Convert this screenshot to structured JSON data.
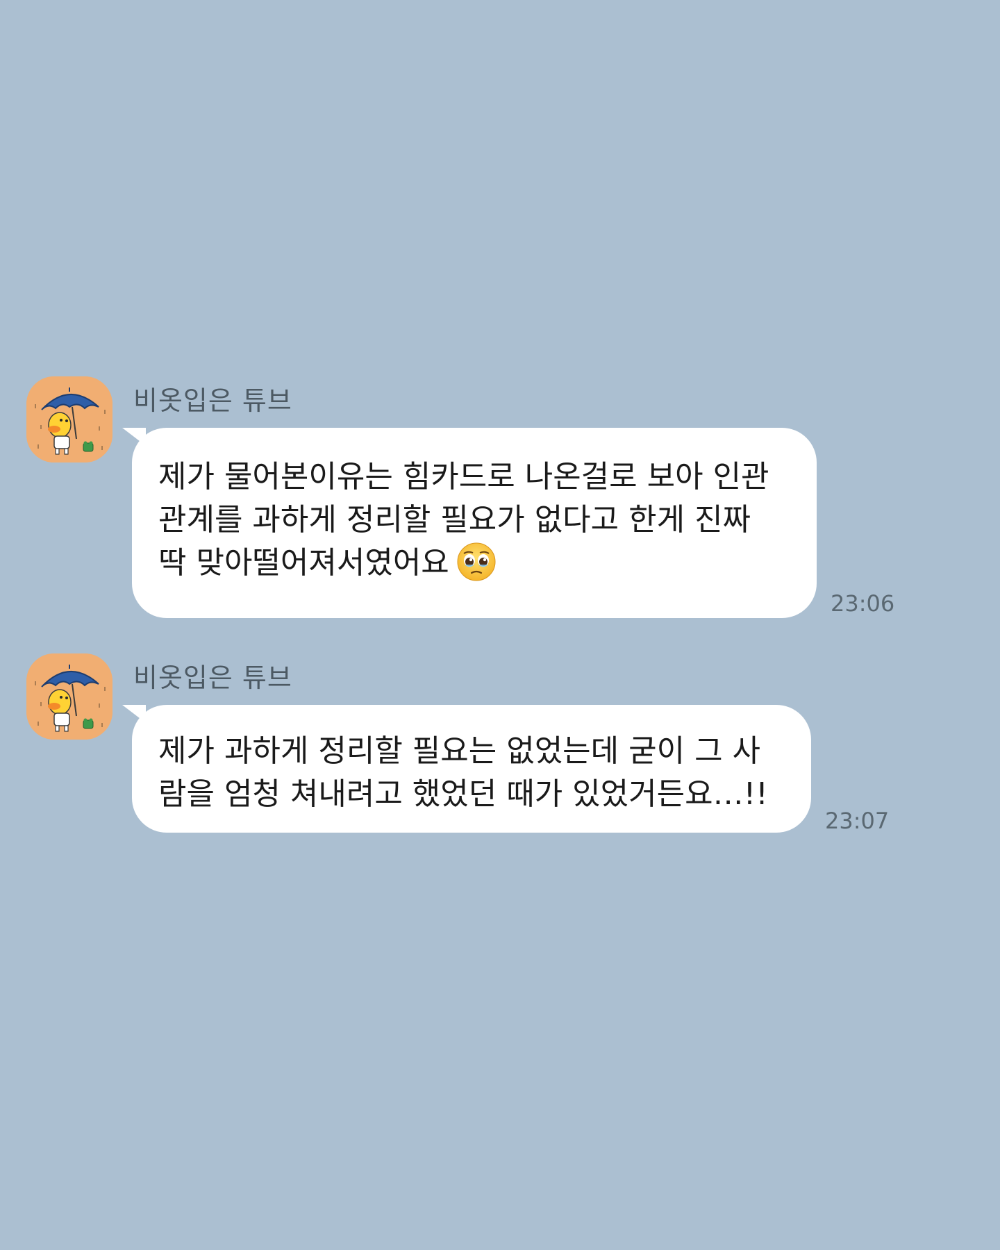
{
  "chat": {
    "messages": [
      {
        "sender": "비옷입은 튜브",
        "avatar_icon": "tube-duck-umbrella-avatar",
        "text": "제가 물어본이유는 힘카드로 나온걸로 보아 인관\n관계를 과하게 정리할 필요가 없다고 한게 진짜\n딱 맞아떨어져서였어요",
        "emoji": "pleading-face",
        "time": "23:06"
      },
      {
        "sender": "비옷입은 튜브",
        "avatar_icon": "tube-duck-umbrella-avatar",
        "text": "제가 과하게 정리할 필요는 없었는데 굳이 그 사\n람을 엄청 쳐내려고 했었던 때가 있었거든요…!!",
        "time": "23:07"
      }
    ]
  },
  "colors": {
    "background": "#abbfd1",
    "bubble": "#ffffff",
    "avatar_bg": "#f1ae72",
    "umbrella": "#2e5ea8"
  }
}
